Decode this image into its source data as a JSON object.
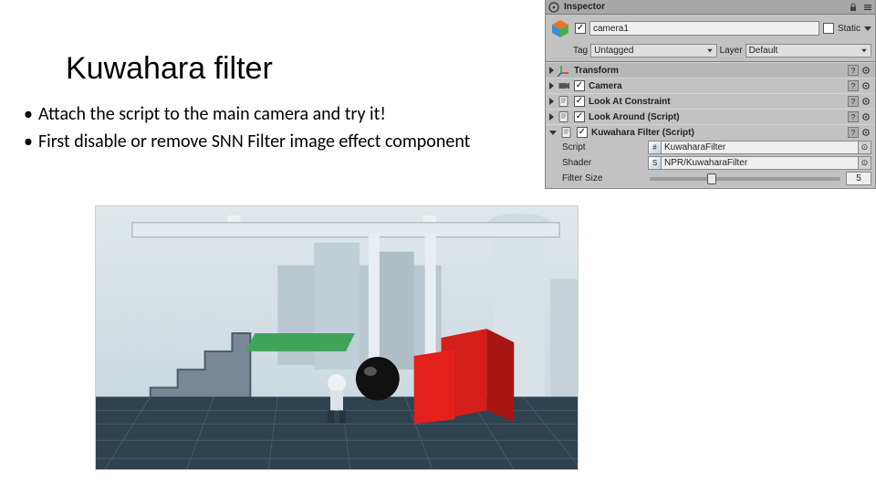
{
  "slide": {
    "title": "Kuwahara filter",
    "bullets": [
      "Attach the script to the main camera and try it!",
      "First disable or remove SNN Filter image effect component"
    ]
  },
  "inspector": {
    "panel_title": "Inspector",
    "object_name": "camera1",
    "static_label": "Static",
    "static_checked": false,
    "tag_label": "Tag",
    "tag_value": "Untagged",
    "layer_label": "Layer",
    "layer_value": "Default",
    "components": [
      {
        "icon": "axes",
        "enabled": true,
        "label": "Transform",
        "checkbox": false
      },
      {
        "icon": "camera",
        "enabled": true,
        "label": "Camera",
        "checkbox": true
      },
      {
        "icon": "script",
        "enabled": true,
        "label": "Look At Constraint",
        "checkbox": true
      },
      {
        "icon": "script",
        "enabled": true,
        "label": "Look Around (Script)",
        "checkbox": true
      },
      {
        "icon": "script",
        "enabled": true,
        "label": "Kuwahara Filter (Script)",
        "checkbox": true,
        "open": true
      }
    ],
    "props": {
      "script_label": "Script",
      "script_value": "KuwaharaFilter",
      "shader_label": "Shader",
      "shader_value": "NPR/KuwaharaFilter",
      "filter_label": "Filter Size",
      "filter_value": "5"
    }
  }
}
